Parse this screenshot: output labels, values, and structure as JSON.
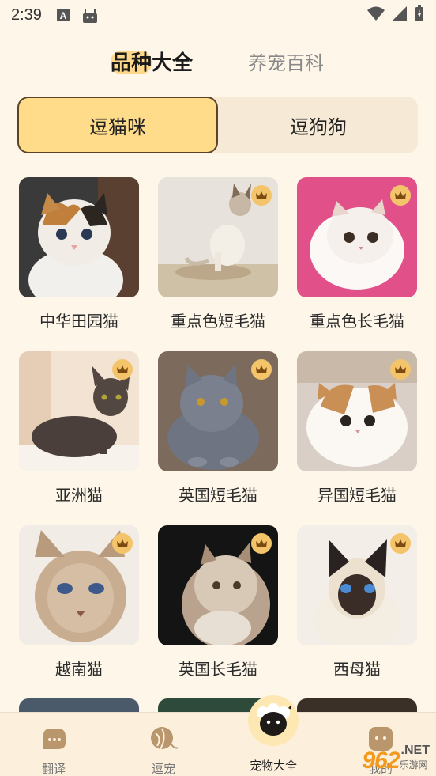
{
  "status_bar": {
    "time": "2:39"
  },
  "top_tabs": [
    {
      "label": "品种大全",
      "active": true
    },
    {
      "label": "养宠百科",
      "active": false
    }
  ],
  "segments": [
    {
      "label": "逗猫咪",
      "active": true
    },
    {
      "label": "逗狗狗",
      "active": false
    }
  ],
  "breeds": [
    {
      "name": "中华田园猫",
      "vip": false
    },
    {
      "name": "重点色短毛猫",
      "vip": true
    },
    {
      "name": "重点色长毛猫",
      "vip": true
    },
    {
      "name": "亚洲猫",
      "vip": true
    },
    {
      "name": "英国短毛猫",
      "vip": true
    },
    {
      "name": "异国短毛猫",
      "vip": true
    },
    {
      "name": "越南猫",
      "vip": true
    },
    {
      "name": "英国长毛猫",
      "vip": true
    },
    {
      "name": "西母猫",
      "vip": true
    }
  ],
  "bottom_nav": [
    {
      "label": "翻译",
      "icon": "chat-bubble-icon"
    },
    {
      "label": "逗宠",
      "icon": "yarn-ball-icon"
    },
    {
      "label": "宠物大全",
      "icon": "sheep-face-icon",
      "active": true
    },
    {
      "label": "我的",
      "icon": "profile-icon"
    }
  ],
  "watermark": {
    "number": "962",
    "suffix": ".NET",
    "sub": "乐游网"
  },
  "colors": {
    "background": "#fdf6e9",
    "accent": "#ffdc8a",
    "vip_badge": "#f4c46a",
    "nav_bg": "#fcf0dc"
  }
}
